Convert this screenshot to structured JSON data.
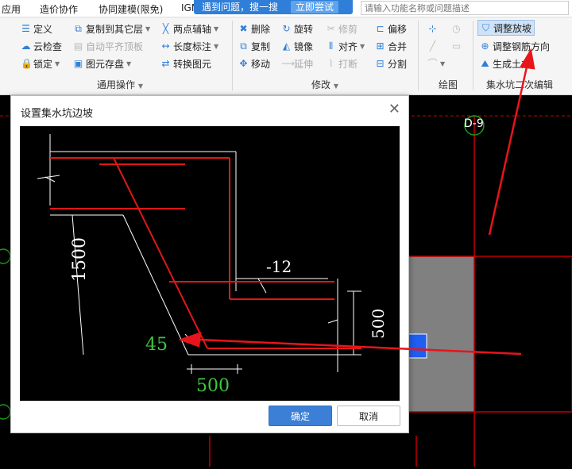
{
  "menu": {
    "items": [
      "应用",
      "造价协作",
      "协同建模(限免)",
      "IGN"
    ]
  },
  "banner": {
    "text": "遇到问题，搜一搜",
    "button": "立即尝试"
  },
  "search": {
    "placeholder": "请输入功能名称或问题描述"
  },
  "ribbon": {
    "common": {
      "define": "定义",
      "copy_to_other_floor": "复制到其它层",
      "two_point_axis": "两点辅轴",
      "cloud_check": "云检查",
      "auto_level_slab": "自动平齐顶板",
      "length_dim": "长度标注",
      "lock": "锁定",
      "element_save": "图元存盘",
      "convert_element": "转换图元",
      "label": "通用操作"
    },
    "modify": {
      "delete": "删除",
      "rotate": "旋转",
      "trim": "修剪",
      "offset": "偏移",
      "copy": "复制",
      "mirror": "镜像",
      "align": "对齐",
      "merge": "合并",
      "move": "移动",
      "extend": "延伸",
      "break": "打断",
      "split": "分割",
      "label": "修改"
    },
    "draw": {
      "label": "绘图"
    },
    "sump_edit": {
      "adjust_slope": "调整放坡",
      "adjust_rebar_dir": "调整钢筋方向",
      "generate_earthwork": "生成土方",
      "label": "集水坑二次编辑"
    }
  },
  "canvas": {
    "axis_label": "D-9"
  },
  "dialog": {
    "title": "设置集水坑边坡",
    "ok": "确定",
    "cancel": "取消",
    "diagram": {
      "dim_height": "1500",
      "dim_offset": "500",
      "dim_depth": "500",
      "elevation": "-12",
      "angle": "45"
    }
  }
}
